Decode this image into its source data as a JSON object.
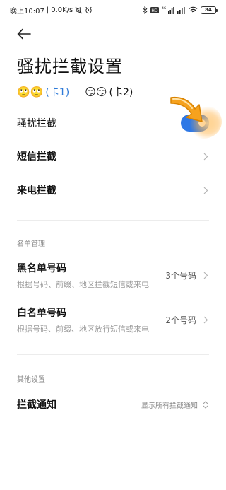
{
  "status_bar": {
    "time": "晚上10:07",
    "net_speed": "0.0K/s",
    "battery": "84",
    "network_label": "4G"
  },
  "header": {
    "title": "骚扰拦截设置"
  },
  "sim": {
    "sim1_emoji": "🙄🙄",
    "sim1_label": "(卡1)",
    "sim2_emoji": "😏😏",
    "sim2_label": "(卡2)"
  },
  "main": {
    "harassment_label": "骚扰拦截",
    "harassment_enabled": true,
    "sms_label": "短信拦截",
    "call_label": "来电拦截"
  },
  "list_management": {
    "section_label": "名单管理",
    "blacklist_title": "黑名单号码",
    "blacklist_desc": "根据号码、前缀、地区拦截短信或来电",
    "blacklist_count": "3个号码",
    "whitelist_title": "白名单号码",
    "whitelist_desc": "根据号码、前缀、地区放行短信或来电",
    "whitelist_count": "2个号码"
  },
  "other": {
    "section_label": "其他设置",
    "notify_title": "拦截通知",
    "notify_value": "显示所有拦截通知"
  },
  "colors": {
    "accent": "#2e78e6",
    "sim1_text": "#2f7bd8",
    "arrow_orange": "#f5a623"
  }
}
